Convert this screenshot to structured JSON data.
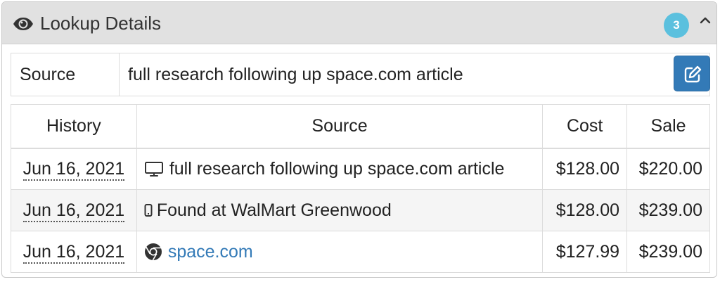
{
  "panel": {
    "title": "Lookup Details",
    "badge_count": "3",
    "title_icon": "eye-icon",
    "toggle_icon": "chevron-up-icon"
  },
  "source_field": {
    "label": "Source",
    "value": "full research following up space.com article",
    "edit_icon": "edit-icon",
    "edit_button_color": "#337ab7"
  },
  "history": {
    "headers": [
      "History",
      "Source",
      "Cost",
      "Sale"
    ],
    "rows": [
      {
        "date": "Jun 16, 2021",
        "icon": "desktop-icon",
        "source": "full research following up space.com article",
        "cost": "$128.00",
        "sale": "$220.00",
        "is_link": false
      },
      {
        "date": "Jun 16, 2021",
        "icon": "mobile-icon",
        "source": "Found at WalMart Greenwood",
        "cost": "$128.00",
        "sale": "$239.00",
        "is_link": false
      },
      {
        "date": "Jun 16, 2021",
        "icon": "chrome-icon",
        "source": "space.com",
        "cost": "$127.99",
        "sale": "$239.00",
        "is_link": true
      }
    ]
  },
  "colors": {
    "header_bg": "#e1e1e1",
    "badge": "#5bc0de",
    "link": "#337ab7"
  }
}
